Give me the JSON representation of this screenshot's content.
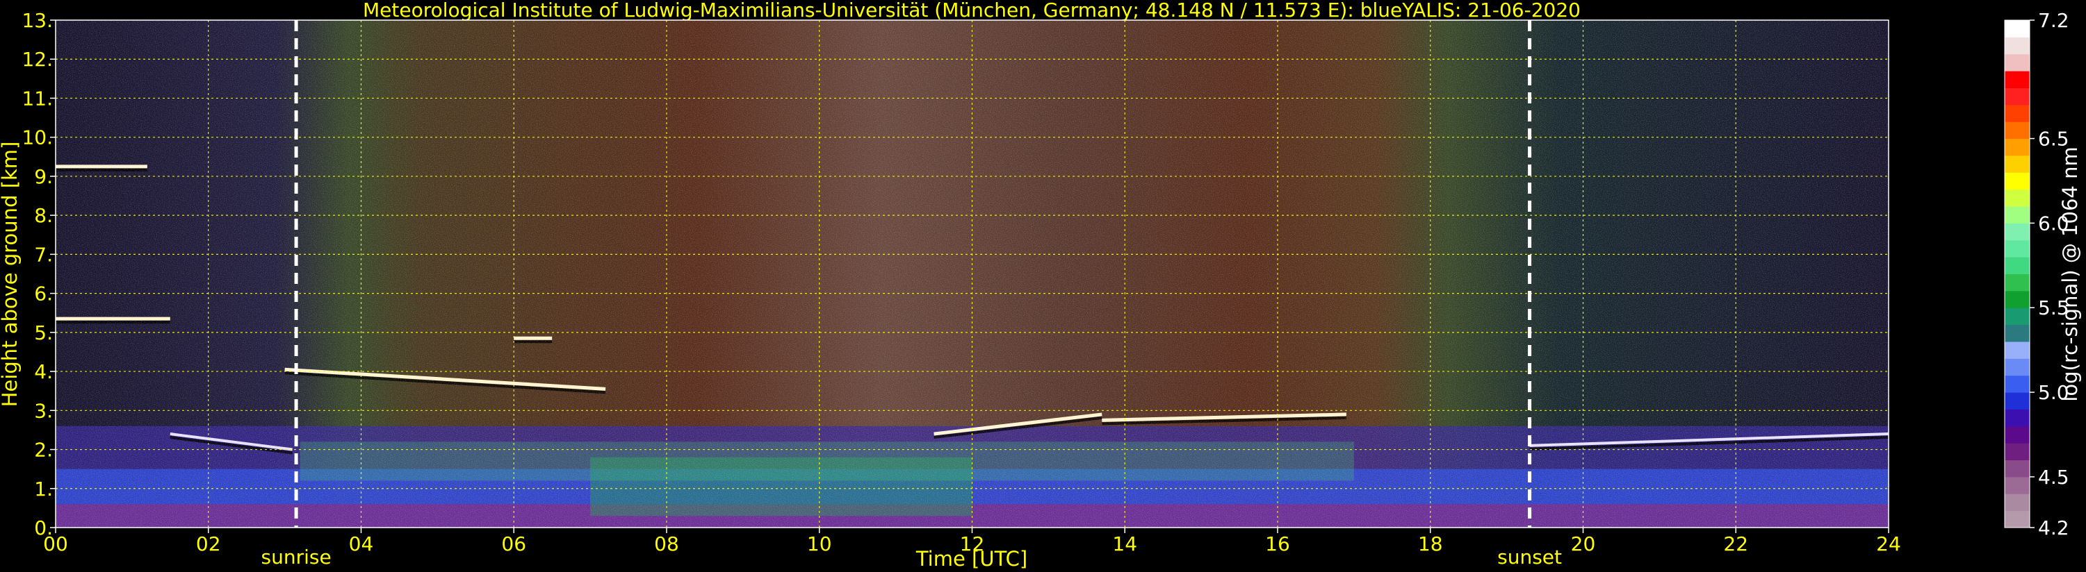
{
  "chart_data": {
    "type": "heatmap",
    "title": "Meteorological Institute of Ludwig-Maximilians-Universität (München, Germany; 48.148 N / 11.573 E):     blueYALIS: 21-06-2020",
    "xlabel": "Time [UTC]",
    "ylabel": "Height above ground [km]",
    "xlim": [
      0,
      24
    ],
    "ylim": [
      0,
      13
    ],
    "x_ticks": [
      "00",
      "02",
      "04",
      "06",
      "08",
      "10",
      "12",
      "14",
      "16",
      "18",
      "20",
      "22",
      "24"
    ],
    "y_ticks": [
      "0.",
      "1.",
      "2.",
      "3.",
      "4.",
      "5.",
      "6.",
      "7.",
      "8.",
      "9.",
      "10.",
      "11.",
      "12.",
      "13."
    ],
    "grid": true,
    "annotations": [
      {
        "label": "sunrise",
        "time": 3.15
      },
      {
        "label": "sunset",
        "time": 19.3
      }
    ],
    "colorbar": {
      "label": "log(rc-signal) @ 1064 nm",
      "range": [
        4.2,
        7.2
      ],
      "ticks": [
        "4.2",
        "4.5",
        "5.0",
        "5.5",
        "6.0",
        "6.5",
        "7.2"
      ],
      "colors": [
        "#b49aaa",
        "#a98aa0",
        "#9c6b95",
        "#8a4b8a",
        "#6f1f7f",
        "#5a0a8a",
        "#3b0fb0",
        "#2030d8",
        "#3a5ff0",
        "#6a8af5",
        "#98b0fa",
        "#2a7a80",
        "#1a9a70",
        "#10a030",
        "#30c050",
        "#40d880",
        "#60e8a0",
        "#80f0b0",
        "#a0ff80",
        "#d0ff40",
        "#ffff00",
        "#ffd000",
        "#ffa000",
        "#ff7000",
        "#ff4000",
        "#ff2020",
        "#ff0000",
        "#f0c0c0",
        "#f0e0e0",
        "#ffffff"
      ]
    },
    "features": [
      {
        "kind": "cloud_layer",
        "start": 3.0,
        "end": 7.2,
        "height": [
          4.05,
          3.55
        ]
      },
      {
        "kind": "cloud_layer",
        "start": 11.5,
        "end": 13.7,
        "height": [
          2.4,
          2.9
        ]
      },
      {
        "kind": "cloud_layer",
        "start": 13.7,
        "end": 16.9,
        "height": [
          2.75,
          2.9
        ]
      },
      {
        "kind": "cloud_layer",
        "start": 0.0,
        "end": 1.5,
        "height": [
          5.35,
          5.35
        ]
      },
      {
        "kind": "cloud_layer",
        "start": 6.0,
        "end": 6.5,
        "height": [
          4.85,
          4.85
        ]
      },
      {
        "kind": "cloud_layer",
        "start": 0.0,
        "end": 1.2,
        "height": [
          9.25,
          9.25
        ]
      },
      {
        "kind": "boundary_layer",
        "start": 1.5,
        "end": 3.1,
        "height": [
          2.4,
          2.0
        ]
      },
      {
        "kind": "boundary_layer",
        "start": 19.3,
        "end": 24.0,
        "height": [
          2.1,
          2.4
        ]
      }
    ]
  }
}
